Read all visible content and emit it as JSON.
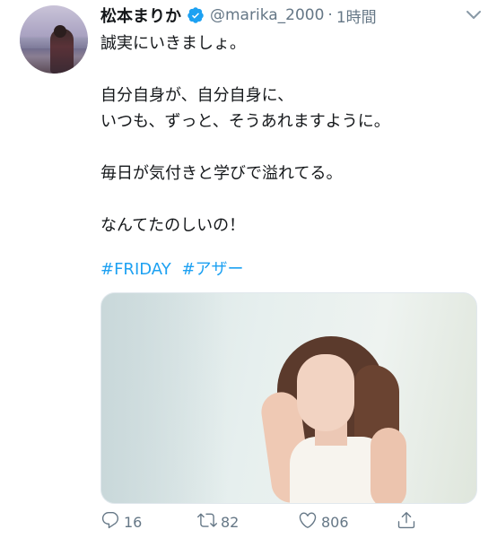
{
  "tweet": {
    "author_name": "松本まりか",
    "handle": "@marika_2000",
    "separator": "·",
    "time": "1時間",
    "lines": [
      "誠実にいきましょ。",
      "",
      "自分自身が、自分自身に、",
      "いつも、ずっと、そうあれますように。",
      "",
      "毎日が気付きと学びで溢れてる。",
      "",
      "なんてたのしいの！"
    ],
    "hashtags": [
      "#FRIDAY",
      "#アザー"
    ],
    "actions": {
      "reply_count": "16",
      "retweet_count": "82",
      "like_count": "806"
    }
  },
  "icons": {
    "verified": "verified-badge-icon",
    "caret": "chevron-down-icon",
    "reply": "reply-icon",
    "retweet": "retweet-icon",
    "like": "heart-icon",
    "share": "share-icon"
  },
  "colors": {
    "link": "#1da1f2",
    "secondary_text": "#657786",
    "primary_text": "#14171a"
  }
}
